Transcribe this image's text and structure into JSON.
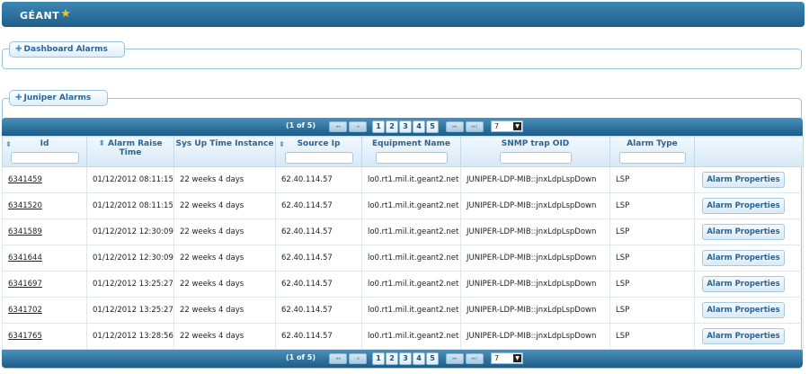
{
  "header": {
    "logo_text": "GÉANT",
    "logo_star": "★"
  },
  "dashboard_panel": {
    "title": "Dashboard Alarms"
  },
  "juniper_panel": {
    "title": "Juniper Alarms"
  },
  "paginator": {
    "count": "(1 of 5)",
    "first": "◂◂",
    "prev": "◂",
    "pages": [
      "1",
      "2",
      "3",
      "4",
      "5"
    ],
    "next": "▸▸",
    "last": "▸▸|",
    "rows_per_page": "7",
    "dropdown_arrow": "▼"
  },
  "table": {
    "columns": [
      "Id",
      "Alarm Raise Time",
      "Sys Up Time Instance",
      "Source Ip",
      "Equipment Name",
      "SNMP trap OID",
      "Alarm Type",
      ""
    ],
    "action_label": "Alarm Properties",
    "rows": [
      {
        "id": "6341459",
        "raise_time": "01/12/2012 08:11:15",
        "sys_up": "22 weeks 4 days",
        "source_ip": "62.40.114.57",
        "equipment": "lo0.rt1.mil.it.geant2.net",
        "oid": "JUNIPER-LDP-MIB::jnxLdpLspDown",
        "type": "LSP"
      },
      {
        "id": "6341520",
        "raise_time": "01/12/2012 08:11:15",
        "sys_up": "22 weeks 4 days",
        "source_ip": "62.40.114.57",
        "equipment": "lo0.rt1.mil.it.geant2.net",
        "oid": "JUNIPER-LDP-MIB::jnxLdpLspDown",
        "type": "LSP"
      },
      {
        "id": "6341589",
        "raise_time": "01/12/2012 12:30:09",
        "sys_up": "22 weeks 4 days",
        "source_ip": "62.40.114.57",
        "equipment": "lo0.rt1.mil.it.geant2.net",
        "oid": "JUNIPER-LDP-MIB::jnxLdpLspDown",
        "type": "LSP"
      },
      {
        "id": "6341644",
        "raise_time": "01/12/2012 12:30:09",
        "sys_up": "22 weeks 4 days",
        "source_ip": "62.40.114.57",
        "equipment": "lo0.rt1.mil.it.geant2.net",
        "oid": "JUNIPER-LDP-MIB::jnxLdpLspDown",
        "type": "LSP"
      },
      {
        "id": "6341697",
        "raise_time": "01/12/2012 13:25:27",
        "sys_up": "22 weeks 4 days",
        "source_ip": "62.40.114.57",
        "equipment": "lo0.rt1.mil.it.geant2.net",
        "oid": "JUNIPER-LDP-MIB::jnxLdpLspDown",
        "type": "LSP"
      },
      {
        "id": "6341702",
        "raise_time": "01/12/2012 13:25:27",
        "sys_up": "22 weeks 4 days",
        "source_ip": "62.40.114.57",
        "equipment": "lo0.rt1.mil.it.geant2.net",
        "oid": "JUNIPER-LDP-MIB::jnxLdpLspDown",
        "type": "LSP"
      },
      {
        "id": "6341765",
        "raise_time": "01/12/2012 13:28:56",
        "sys_up": "22 weeks 4 days",
        "source_ip": "62.40.114.57",
        "equipment": "lo0.rt1.mil.it.geant2.net",
        "oid": "JUNIPER-LDP-MIB::jnxLdpLspDown",
        "type": "LSP"
      }
    ]
  }
}
